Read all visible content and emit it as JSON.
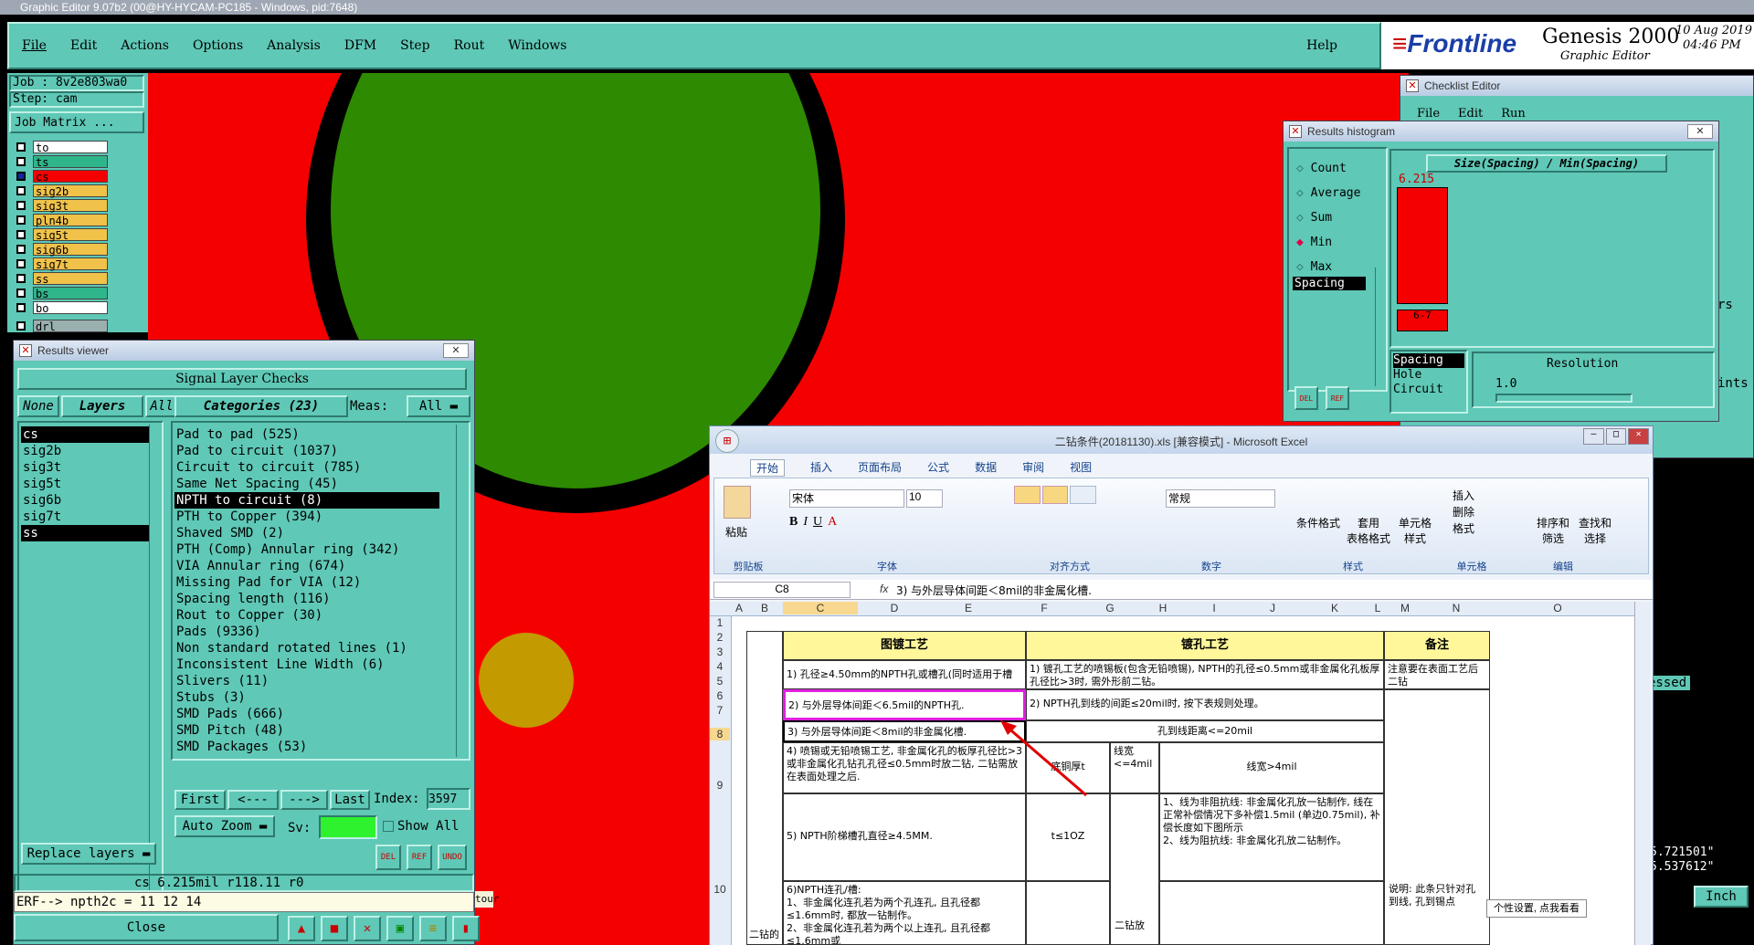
{
  "app": {
    "title_bar": "Graphic Editor 9.07b2 (00@HY-HYCAM-PC185 - Windows, pid:7648)"
  },
  "menu": [
    "File",
    "Edit",
    "Actions",
    "Options",
    "Analysis",
    "DFM",
    "Step",
    "Rout",
    "Windows"
  ],
  "help": "Help",
  "brand": {
    "logo": "Frontline",
    "product": "Genesis 2000",
    "subtitle": "Graphic Editor",
    "date": "10 Aug 2019",
    "time": "04:46 PM"
  },
  "job": {
    "job": "Job : 8v2e803wa0",
    "step": "Step: cam",
    "matrix": "Job Matrix ..."
  },
  "layers": [
    "to",
    "ts",
    "cs",
    "sig2b",
    "sig3t",
    "pln4b",
    "sig5t",
    "sig6b",
    "sig7t",
    "ss",
    "bs",
    "bo",
    "drl"
  ],
  "results_viewer": {
    "title": "Results viewer",
    "header": "Signal Layer Checks",
    "none": "None",
    "layers_label": "Layers",
    "all": "All",
    "categories_label": "Categories (23)",
    "meas": "Meas:",
    "meas_val": "All",
    "layer_list": [
      "cs",
      "sig2b",
      "sig3t",
      "sig5t",
      "sig6b",
      "sig7t",
      "ss"
    ],
    "categories": [
      "Pad to pad (525)",
      "Pad to circuit (1037)",
      "Circuit to circuit (785)",
      "Same Net Spacing (45)",
      "NPTH to circuit (8)",
      "PTH to Copper (394)",
      "Shaved SMD (2)",
      "PTH (Comp) Annular ring (342)",
      "VIA Annular ring (674)",
      "Missing Pad for VIA (12)",
      "Spacing length (116)",
      "Rout to Copper (30)",
      "Pads (9336)",
      "Non standard rotated lines (1)",
      "Inconsistent Line Width (6)",
      "Slivers (11)",
      "Stubs (3)",
      "SMD Pads (666)",
      "SMD Pitch (48)",
      "SMD Packages (53)"
    ],
    "first": "First",
    "prev": "<---",
    "next": "--->",
    "last": "Last",
    "index_label": "Index:",
    "index_val": "3597",
    "auto_zoom": "Auto Zoom",
    "sv": "Sv:",
    "show_all": "Show All",
    "replace_layers": "Replace layers",
    "status": "cs 6.215mil  r118.11  r0",
    "erf": "ERF--> npth2c = 11 12 14",
    "close": "Close",
    "del": "DEL",
    "ref": "REF",
    "undo": "UNDO"
  },
  "histogram": {
    "title": "Results histogram",
    "options": [
      "Count",
      "Average",
      "Sum",
      "Min",
      "Max"
    ],
    "selected": "Min",
    "list": [
      "Spacing"
    ],
    "chart_title": "Size(Spacing) / Min(Spacing)",
    "bar_value": "6.215",
    "bar_label": "6-7",
    "bottom_list": [
      "Spacing",
      "Hole",
      "Circuit"
    ],
    "resolution_label": "Resolution",
    "resolution_val": "1.0",
    "del": "DEL",
    "ref": "REF"
  },
  "checklist": {
    "title": "Checklist Editor",
    "menu": [
      "File",
      "Edit",
      "Run"
    ],
    "fragment": "essed"
  },
  "side_fragments": {
    "coord1": "5.721501\"",
    "coord2": "5.537612\"",
    "inch": "Inch",
    "tour": "tour",
    "rs": "rs",
    "ints": "ints"
  },
  "excel": {
    "title": "二钻条件(20181130).xls [兼容模式] - Microsoft Excel",
    "tabs": [
      "开始",
      "插入",
      "页面布局",
      "公式",
      "数据",
      "审阅",
      "视图"
    ],
    "font_name": "宋体",
    "font_size": "10",
    "number_format": "常规",
    "ribbon_groups": [
      "剪贴板",
      "字体",
      "对齐方式",
      "数字",
      "样式",
      "单元格",
      "编辑"
    ],
    "ribbon_buttons": [
      "粘贴",
      "条件格式",
      "套用\n表格格式",
      "单元格\n样式",
      "插入",
      "删除",
      "格式",
      "排序和\n筛选",
      "查找和\n选择"
    ],
    "name_box": "C8",
    "formula": "3) 与外层导体间距＜8mil的非金属化槽.",
    "columns": [
      "A",
      "B",
      "C",
      "D",
      "E",
      "F",
      "G",
      "H",
      "I",
      "J",
      "K",
      "L",
      "M",
      "N",
      "O"
    ],
    "rows": [
      "1",
      "2",
      "3",
      "4",
      "5",
      "6",
      "7",
      "8",
      "9",
      "10"
    ],
    "header_c": "图镀工艺",
    "header_g": "镀孔工艺",
    "header_o": "备注",
    "r4": "1) 孔径≥4.50mm的NPTH孔或槽孔(同时适用于槽长)",
    "r4g": "1) 镀孔工艺的喷锡板(包含无铅喷锡), NPTH的孔径≤0.5mm或非金属化孔板厚孔径比>3时, 需外形前二钻。",
    "r4o": "注意要在表面工艺后二钻",
    "r6": "2) 与外层导体间距＜6.5mil的NPTH孔.",
    "r6g": "2) NPTH孔到线的间距≤20mil时, 按下表规则处理。",
    "r8": "3) 与外层导体间距＜8mil的非金属化槽.",
    "r8g": "孔到线距离<=20mil",
    "r9": "4) 喷锡或无铅喷锡工艺, 非金属化孔的板厚孔径比>3或非金属化孔钻孔孔径≤0.5mm时放二钻, 二钻需放在表面处理之后.",
    "r9h": "底铜厚t",
    "r9i": "线宽<=4mil",
    "r9k": "线宽>4mil",
    "r10": "5) NPTH阶梯槽孔直径≥4.5MM.",
    "r10h": "t≤1OZ",
    "r10k": "1、线为非阻抗线: 非金属化孔放一钻制作, 线在正常补偿情况下多补偿1.5mil (单边0.75mil), 补偿长度如下图所示\n2、线为阻抗线: 非金属化孔放二钻制作。",
    "r11": "6)NPTH连孔/槽:\n1、非金属化连孔若为两个孔连孔, 且孔径都≤1.6mm时, 都放一钻制作。\n2、非金属化连孔若为两个以上连孔, 且孔径都≤1.6mm或",
    "r11b": "二钻的",
    "r11i": "二钻放",
    "r11o": "说明: 此条只针对孔到线, 孔到锡点",
    "tooltip": "个性设置, 点我看看"
  },
  "colors": {
    "board_red": "#f50000",
    "pad_green": "#2e8a00",
    "pad_gold": "#c39a00",
    "panel_teal": "#5fc8b6",
    "highlight": "#e020e0"
  }
}
